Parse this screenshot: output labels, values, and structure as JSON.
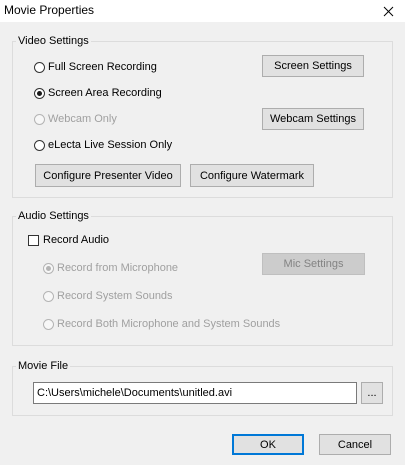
{
  "window": {
    "title": "Movie Properties"
  },
  "video": {
    "label": "Video Settings",
    "full_screen": "Full Screen Recording",
    "screen_area": "Screen Area Recording",
    "webcam_only": "Webcam Only",
    "electa": "eLecta Live Session Only",
    "screen_settings": "Screen Settings",
    "webcam_settings": "Webcam Settings",
    "configure_presenter": "Configure Presenter Video",
    "configure_watermark": "Configure Watermark",
    "selected": "Screen Area Recording"
  },
  "audio": {
    "label": "Audio Settings",
    "record_audio": "Record Audio",
    "record_audio_checked": false,
    "from_mic": "Record from Microphone",
    "system_sounds": "Record System Sounds",
    "both": "Record Both Microphone and System Sounds",
    "mic_settings": "Mic Settings",
    "selected": "Record from Microphone"
  },
  "movie_file": {
    "label": "Movie File",
    "path": "C:\\Users\\michele\\Documents\\unitled.avi",
    "browse": "..."
  },
  "footer": {
    "ok": "OK",
    "cancel": "Cancel"
  },
  "icons": {
    "close": "close-icon"
  }
}
